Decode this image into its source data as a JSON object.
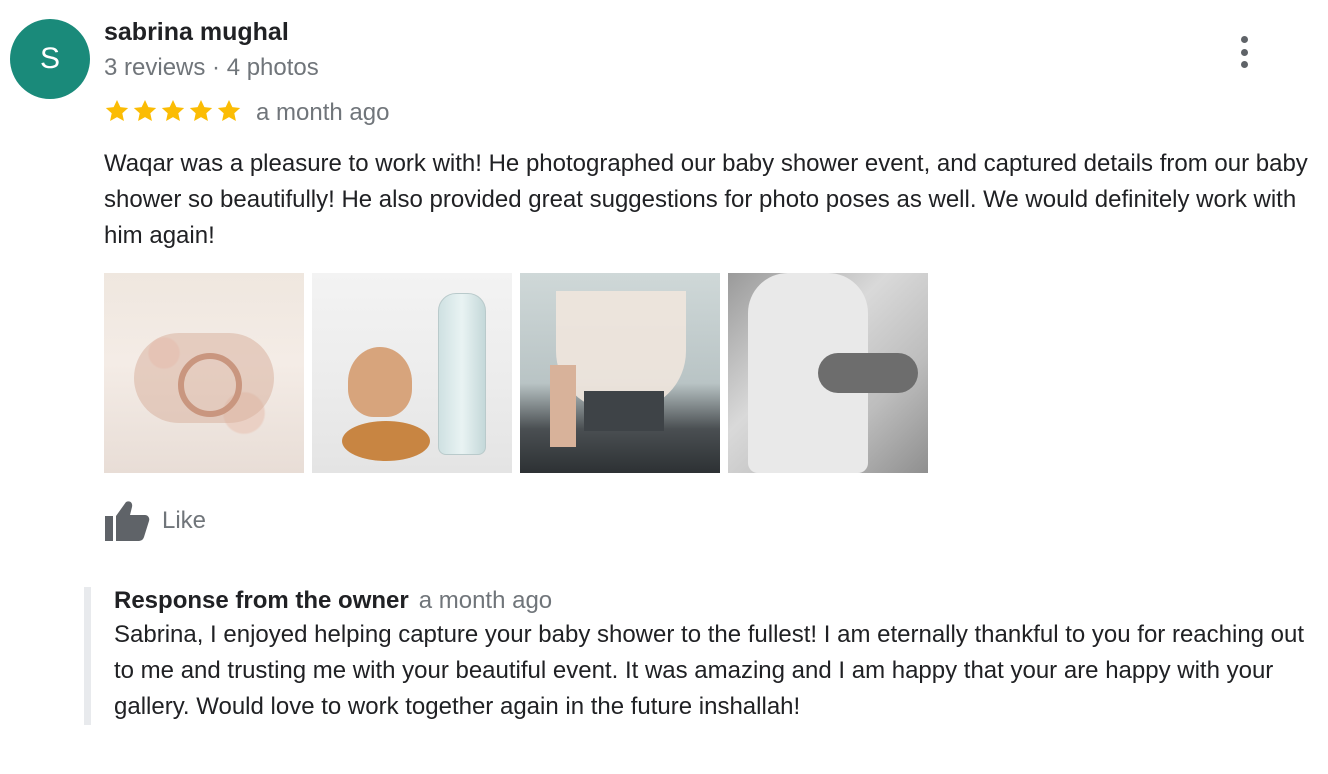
{
  "reviewer": {
    "initial": "S",
    "name": "sabrina mughal",
    "meta": "3 reviews · 4 photos",
    "avatar_color": "#1a8a7a"
  },
  "rating": {
    "stars": 5,
    "max": 5,
    "star_color": "#fbbc04"
  },
  "date": "a month ago",
  "review_text": "Waqar was a pleasure to work with! He photographed our baby shower event, and captured details from our baby shower so beautifully! He also provided great suggestions for photo poses as well. We would definitely work with him again!",
  "photos": [
    {
      "icon": "photo-thumbnail",
      "subject": "belly-heart-hands"
    },
    {
      "icon": "photo-thumbnail",
      "subject": "teddy-bear-bottle"
    },
    {
      "icon": "photo-thumbnail",
      "subject": "baby-blocks-fireplace"
    },
    {
      "icon": "photo-thumbnail",
      "subject": "dress-black-white"
    }
  ],
  "actions": {
    "like_label": "Like",
    "like_icon": "thumbs-up-icon",
    "more_icon": "more-vert-icon"
  },
  "owner_response": {
    "title": "Response from the owner",
    "date": "a month ago",
    "text": "Sabrina, I enjoyed helping capture your baby shower to the fullest! I am eternally thankful to you for reaching out to me and trusting me with your beautiful event. It was amazing and I am happy that your are happy with your gallery. Would love to work together again in the future inshallah!"
  }
}
